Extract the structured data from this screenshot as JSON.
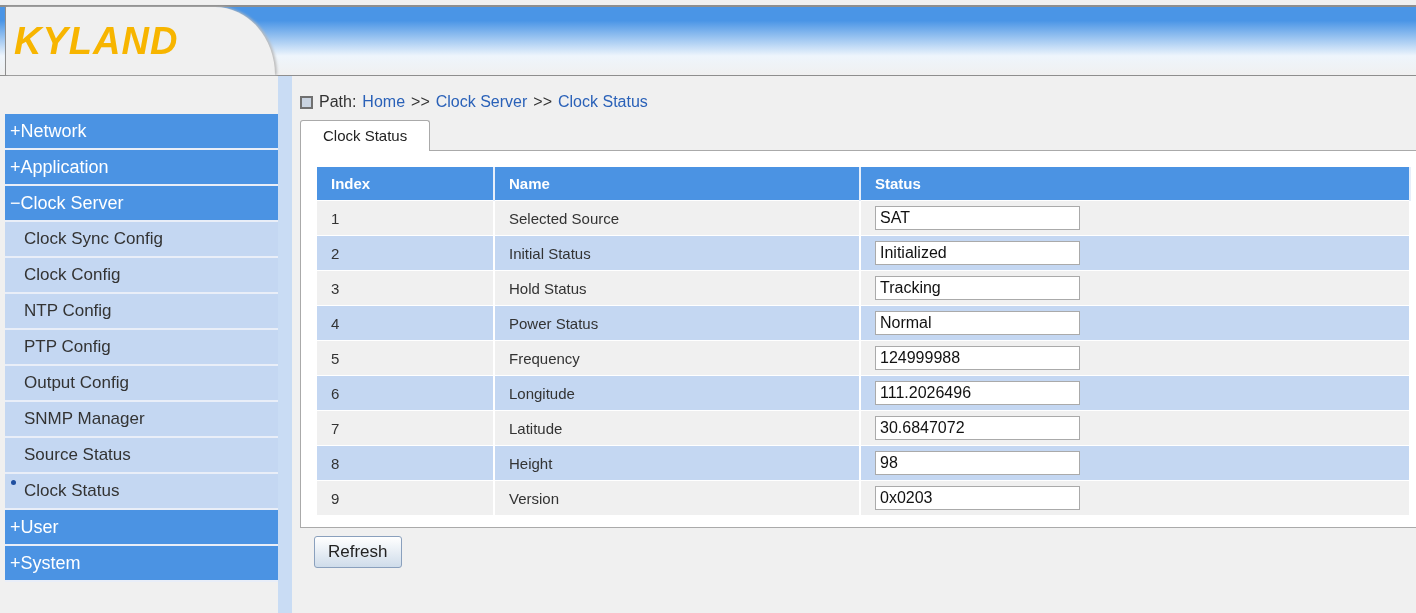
{
  "logo": "KYLAND",
  "sidebar": {
    "items": [
      {
        "kind": "group",
        "sign": "+",
        "label": "Network"
      },
      {
        "kind": "group",
        "sign": "+",
        "label": "Application"
      },
      {
        "kind": "group",
        "sign": "−",
        "label": "Clock Server"
      },
      {
        "kind": "child",
        "label": "Clock Sync Config",
        "selected": false
      },
      {
        "kind": "child",
        "label": "Clock Config",
        "selected": false
      },
      {
        "kind": "child",
        "label": "NTP Config",
        "selected": false
      },
      {
        "kind": "child",
        "label": "PTP Config",
        "selected": false
      },
      {
        "kind": "child",
        "label": "Output Config",
        "selected": false
      },
      {
        "kind": "child",
        "label": "SNMP Manager",
        "selected": false
      },
      {
        "kind": "child",
        "label": "Source Status",
        "selected": false
      },
      {
        "kind": "child",
        "label": "Clock Status",
        "selected": true
      },
      {
        "kind": "group",
        "sign": "+",
        "label": "User"
      },
      {
        "kind": "group",
        "sign": "+",
        "label": "System"
      }
    ]
  },
  "path": {
    "label": "Path:",
    "crumbs": [
      "Home",
      "Clock Server",
      "Clock Status"
    ],
    "separator": ">>"
  },
  "tabs": [
    {
      "label": "Clock Status",
      "selected": true
    }
  ],
  "table": {
    "columns": [
      "Index",
      "Name",
      "Status"
    ],
    "rows": [
      [
        "1",
        "Selected Source",
        "SAT"
      ],
      [
        "2",
        "Initial Status",
        "Initialized"
      ],
      [
        "3",
        "Hold Status",
        "Tracking"
      ],
      [
        "4",
        "Power Status",
        "Normal"
      ],
      [
        "5",
        "Frequency",
        "124999988"
      ],
      [
        "6",
        "Longitude",
        "111.2026496"
      ],
      [
        "7",
        "Latitude",
        "30.6847072"
      ],
      [
        "8",
        "Height",
        "98"
      ],
      [
        "9",
        "Version",
        "0x0203"
      ]
    ]
  },
  "buttons": [
    "Refresh"
  ]
}
